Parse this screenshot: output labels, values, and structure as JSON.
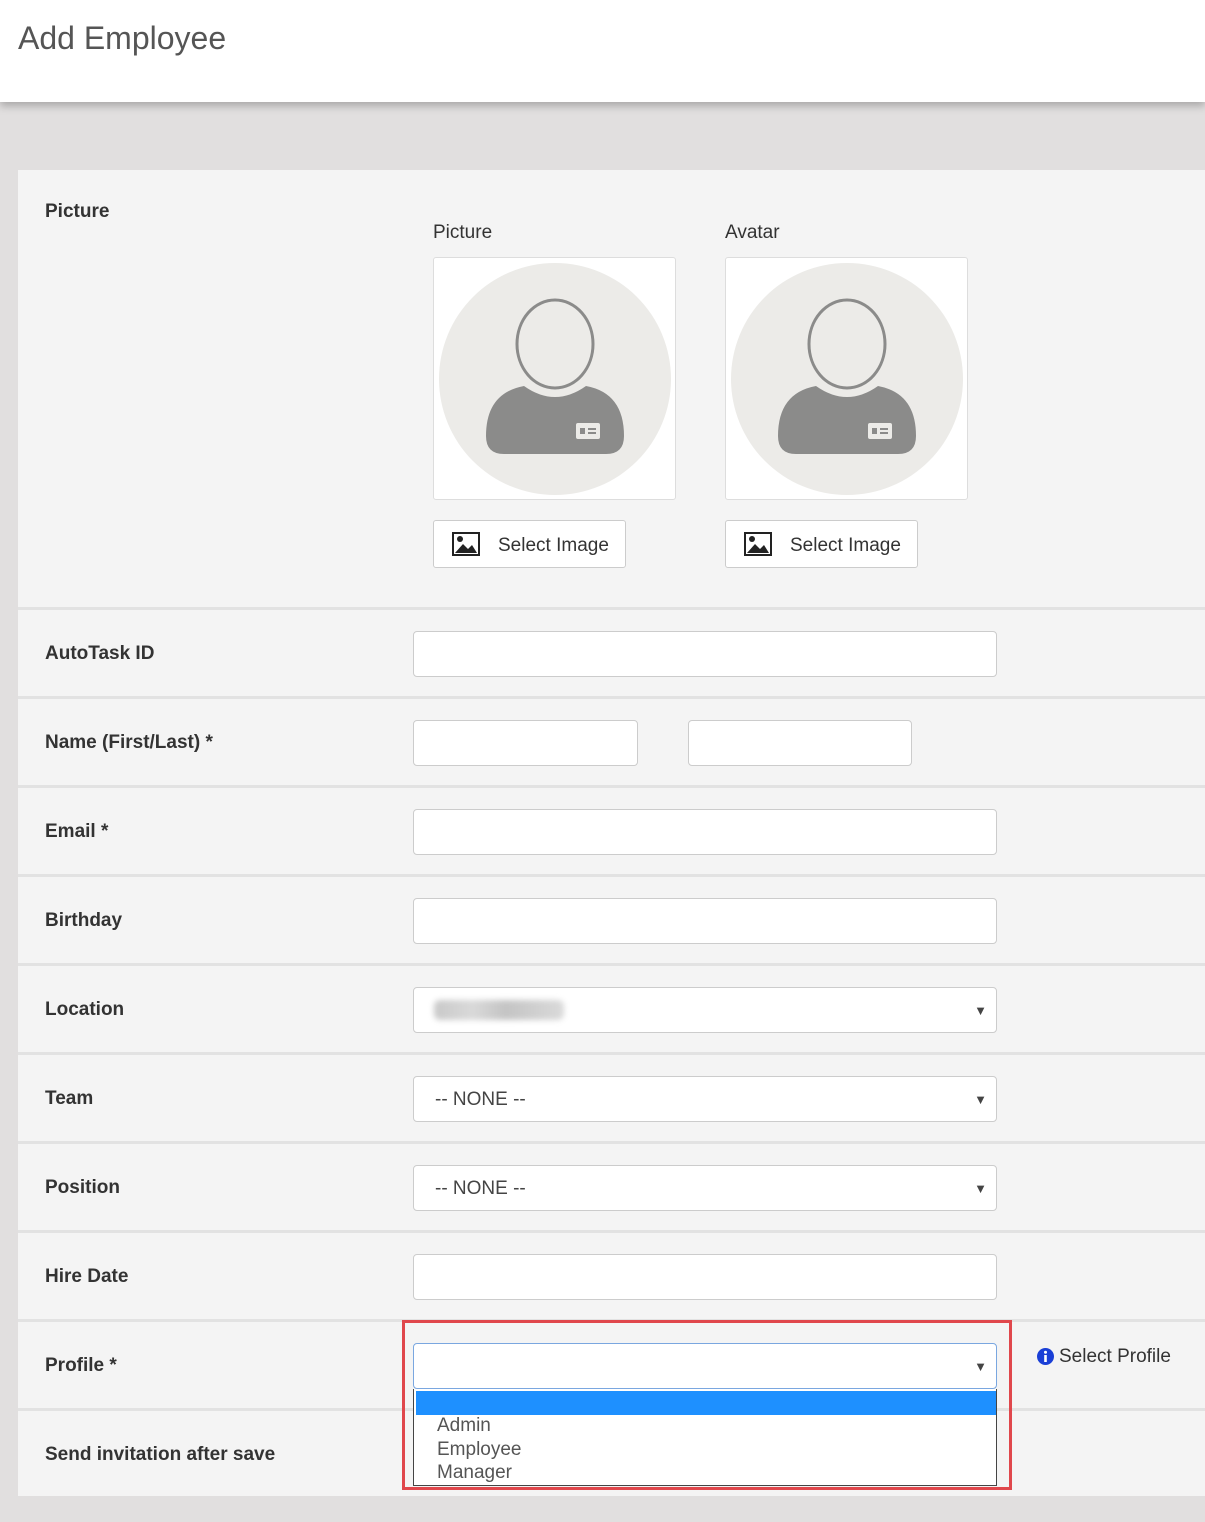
{
  "page": {
    "title": "Add Employee"
  },
  "picture_section": {
    "label": "Picture",
    "picture": {
      "title": "Picture",
      "button_label": "Select Image"
    },
    "avatar": {
      "title": "Avatar",
      "button_label": "Select Image"
    }
  },
  "fields": {
    "autotask": {
      "label": "AutoTask ID",
      "value": ""
    },
    "name": {
      "label": "Name (First/Last) *",
      "first": "",
      "last": ""
    },
    "email": {
      "label": "Email *",
      "value": ""
    },
    "birthday": {
      "label": "Birthday",
      "value": ""
    },
    "location": {
      "label": "Location",
      "value": ""
    },
    "team": {
      "label": "Team",
      "value": "-- NONE --"
    },
    "position": {
      "label": "Position",
      "value": "-- NONE --"
    },
    "hire_date": {
      "label": "Hire Date",
      "value": ""
    },
    "profile": {
      "label": "Profile *",
      "value": "",
      "options": [
        "",
        "Admin",
        "Employee",
        "Manager"
      ],
      "help_label": "Select Profile"
    },
    "send_invitation": {
      "label": "Send invitation after save"
    }
  },
  "colors": {
    "highlight_border": "#e0474c",
    "dropdown_selected": "#1e90ff",
    "info_icon": "#1a3fd6"
  },
  "icons": {
    "picture_placeholder": "user-placeholder-icon",
    "select_image": "image-icon",
    "info": "info-circle-icon",
    "caret": "caret-down-icon"
  }
}
